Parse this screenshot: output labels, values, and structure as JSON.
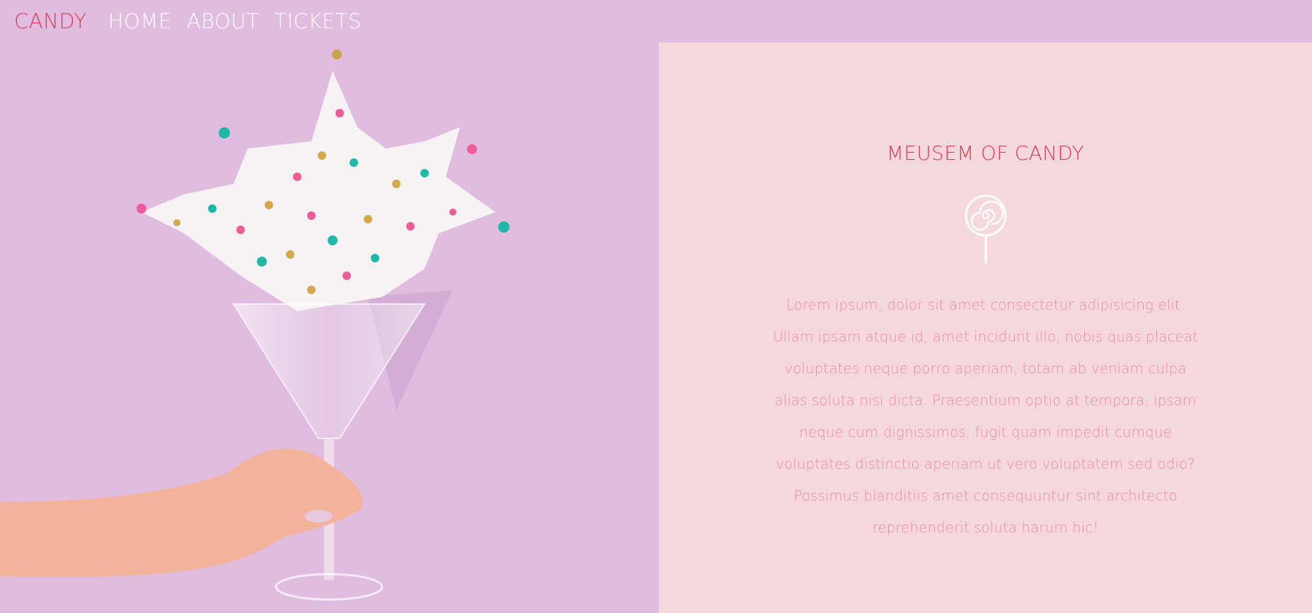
{
  "nav": {
    "brand": "CANDY",
    "links": [
      "HOME",
      "ABOUT",
      "TICKETS"
    ]
  },
  "hero": {
    "image": "hand holding martini glass bursting with candy sprinkles"
  },
  "panel": {
    "title": "MEUSEM OF CANDY",
    "icon": "lollipop-icon",
    "body": "Lorem ipsum, dolor sit amet consectetur adipisicing elit. Ullam ipsam atque id, amet incidunt illo, nobis quas placeat voluptates neque porro aperiam, totam ab veniam culpa alias soluta nisi dicta. Praesentium optio at tempora, ipsam neque cum dignissimos, fugit quam impedit cumque voluptates distinctio aperiam ut vero voluptatem sed odio? Possimus blanditiis amet consequuntur sint architecto reprehenderit soluta harum hic!"
  },
  "colors": {
    "background": "#e0bde0",
    "panel": "#f5d8de",
    "accent": "#e23b55",
    "body_text": "#ef8aa8"
  }
}
